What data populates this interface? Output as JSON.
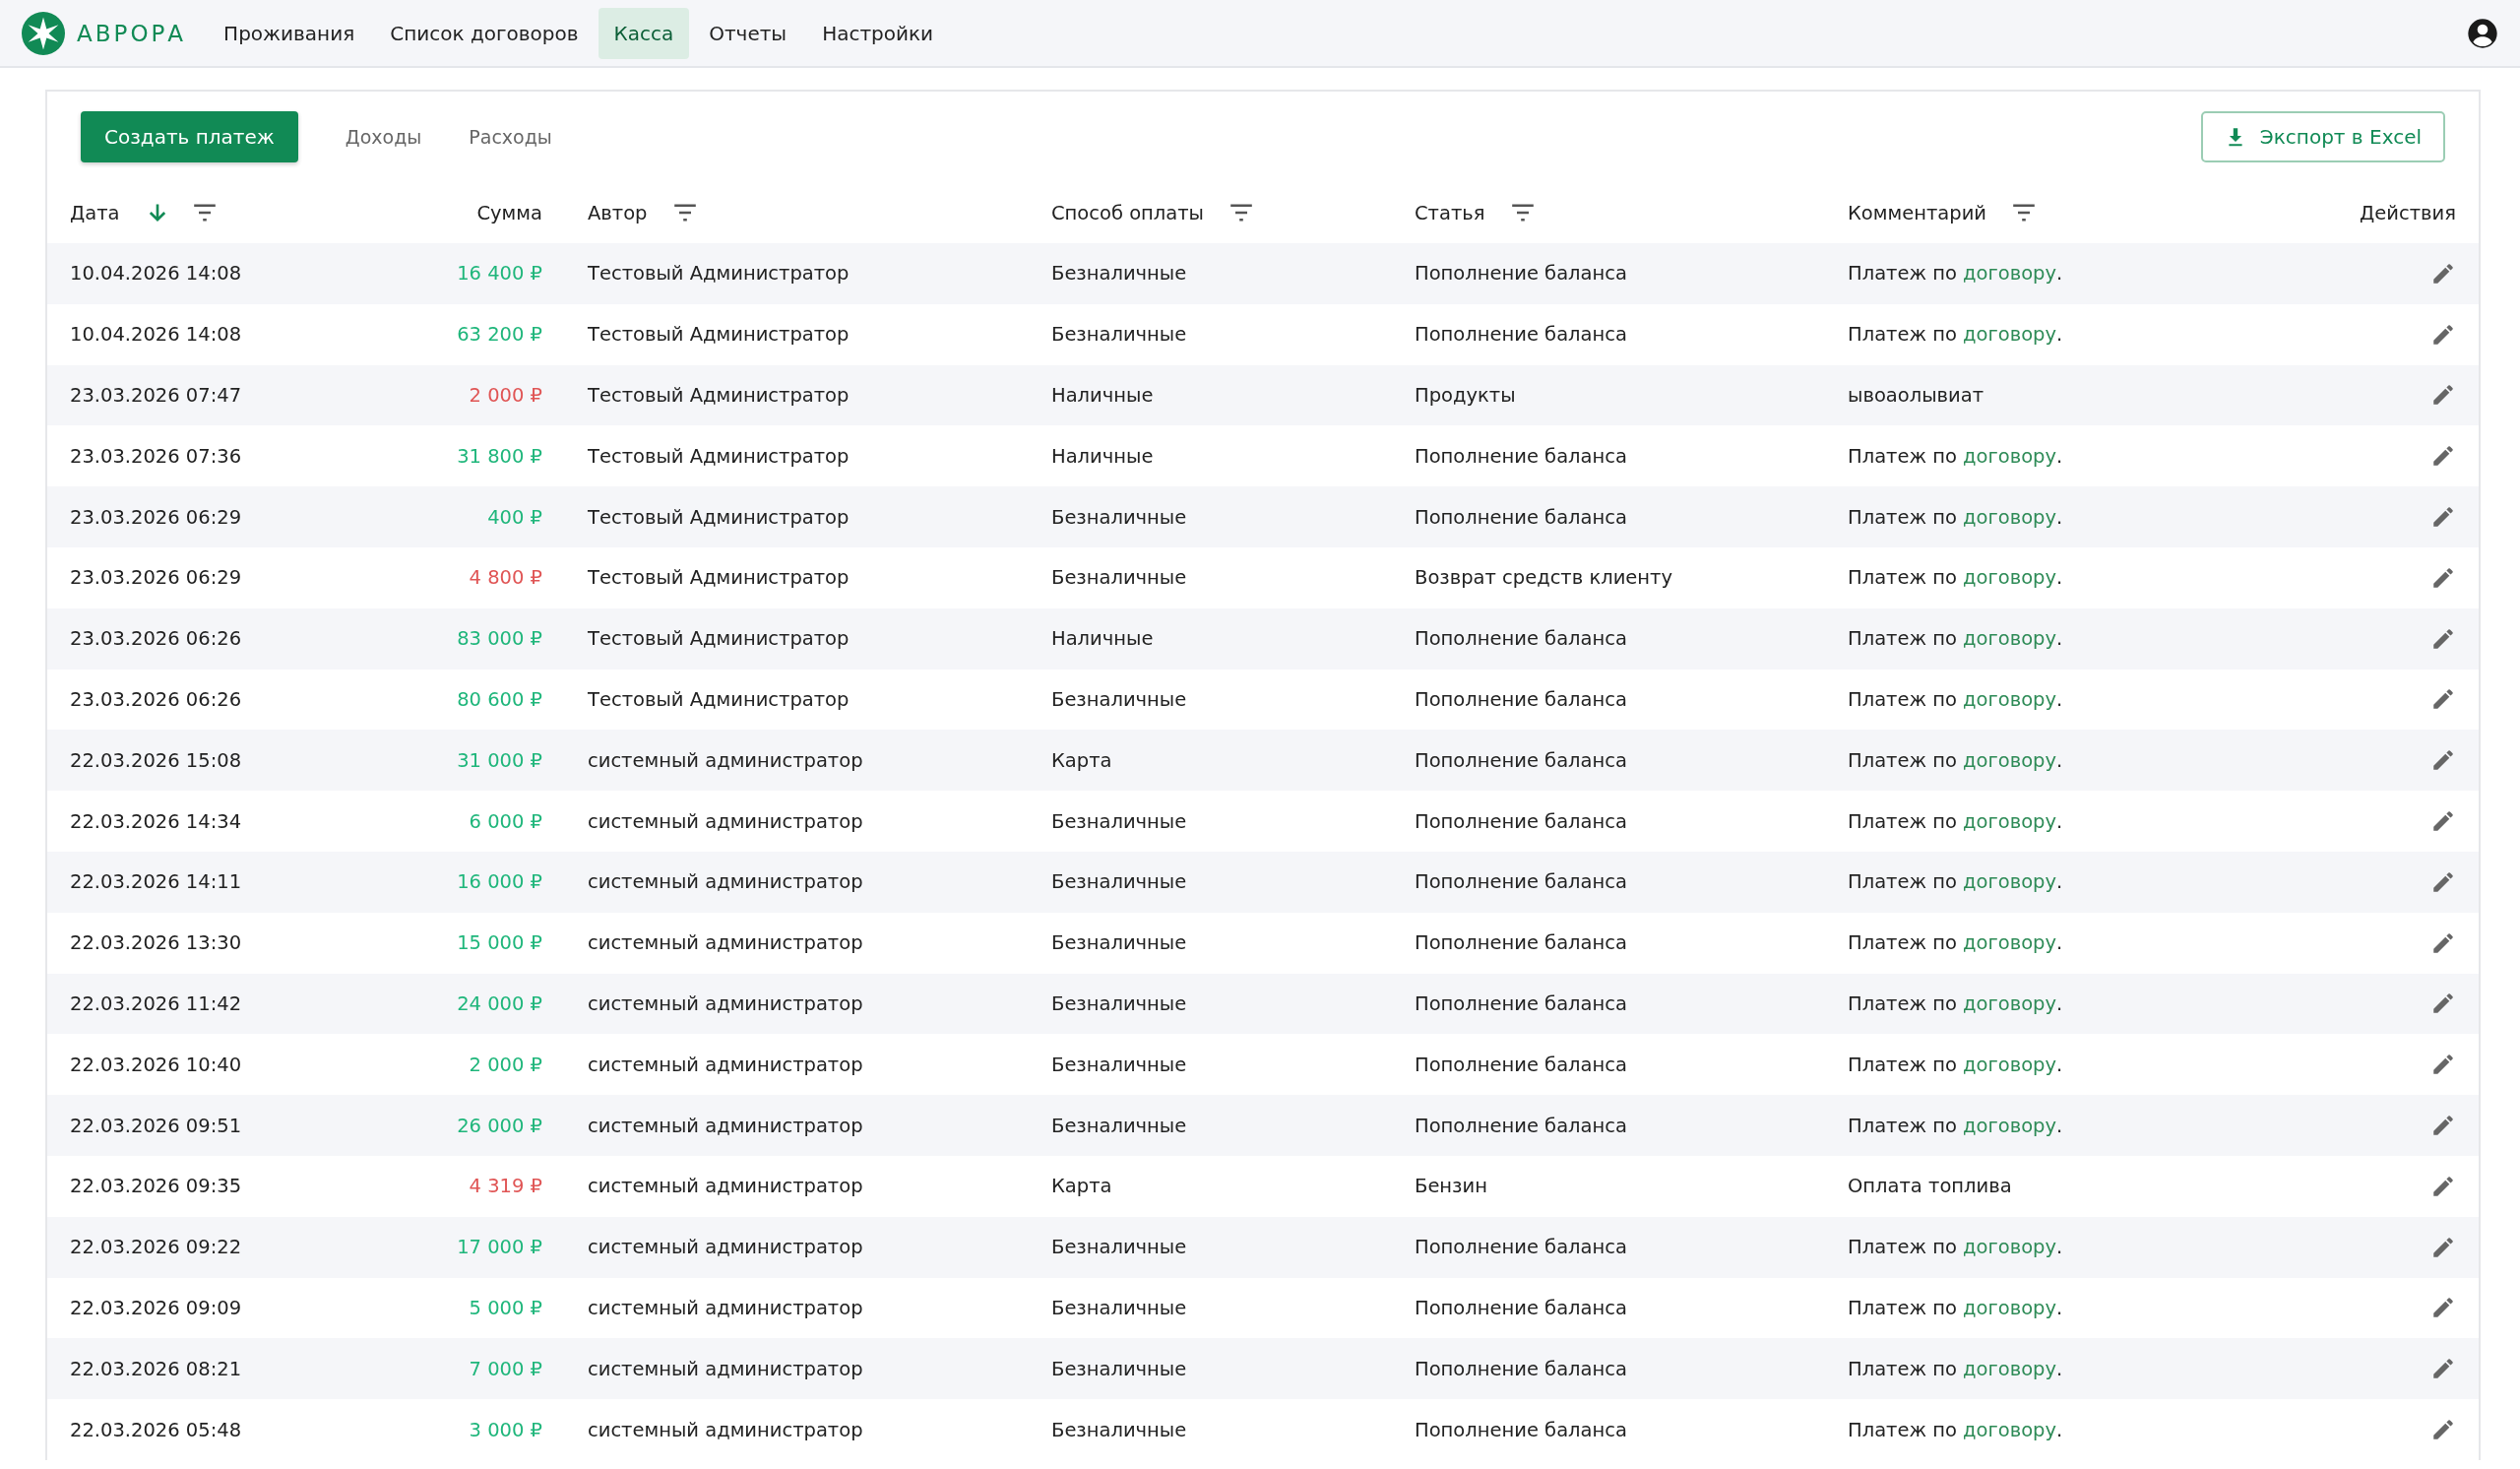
{
  "brand": "АВРОРА",
  "nav": [
    {
      "label": "Проживания",
      "selected": false
    },
    {
      "label": "Список договоров",
      "selected": false
    },
    {
      "label": "Касса",
      "selected": true
    },
    {
      "label": "Отчеты",
      "selected": false
    },
    {
      "label": "Настройки",
      "selected": false
    }
  ],
  "create_button": "Создать платеж",
  "tabs": [
    {
      "label": "Доходы",
      "selected": false
    },
    {
      "label": "Расходы",
      "selected": false
    }
  ],
  "export_button": "Экспорт в Excel",
  "columns": [
    {
      "label": "Дата",
      "sorted": true,
      "filter": true
    },
    {
      "label": "Сумма",
      "sorted": false,
      "filter": false
    },
    {
      "label": "Автор",
      "sorted": false,
      "filter": true
    },
    {
      "label": "Способ оплаты",
      "sorted": false,
      "filter": true
    },
    {
      "label": "Статья",
      "sorted": false,
      "filter": true
    },
    {
      "label": "Комментарий",
      "sorted": false,
      "filter": true
    },
    {
      "label": "Действия",
      "sorted": false,
      "filter": false
    }
  ],
  "rows": [
    {
      "date": "10.04.2026 14:08",
      "amount": "16 400 ₽",
      "kind": "income",
      "author": "Тестовый Администратор",
      "method": "Безналичные",
      "article": "Пополнение баланса",
      "comment": [
        {
          "kind": "text",
          "text": "Платеж по "
        },
        {
          "kind": "link",
          "text": "договору"
        },
        {
          "kind": "text",
          "text": "."
        }
      ]
    },
    {
      "date": "10.04.2026 14:08",
      "amount": "63 200 ₽",
      "kind": "income",
      "author": "Тестовый Администратор",
      "method": "Безналичные",
      "article": "Пополнение баланса",
      "comment": [
        {
          "kind": "text",
          "text": "Платеж по "
        },
        {
          "kind": "link",
          "text": "договору"
        },
        {
          "kind": "text",
          "text": "."
        }
      ]
    },
    {
      "date": "23.03.2026 07:47",
      "amount": "2 000 ₽",
      "kind": "expense",
      "author": "Тестовый Администратор",
      "method": "Наличные",
      "article": "Продукты",
      "comment": [
        {
          "kind": "text",
          "text": "ывоаолывиат"
        }
      ]
    },
    {
      "date": "23.03.2026 07:36",
      "amount": "31 800 ₽",
      "kind": "income",
      "author": "Тестовый Администратор",
      "method": "Наличные",
      "article": "Пополнение баланса",
      "comment": [
        {
          "kind": "text",
          "text": "Платеж по "
        },
        {
          "kind": "link",
          "text": "договору"
        },
        {
          "kind": "text",
          "text": "."
        }
      ]
    },
    {
      "date": "23.03.2026 06:29",
      "amount": "400 ₽",
      "kind": "income",
      "author": "Тестовый Администратор",
      "method": "Безналичные",
      "article": "Пополнение баланса",
      "comment": [
        {
          "kind": "text",
          "text": "Платеж по "
        },
        {
          "kind": "link",
          "text": "договору"
        },
        {
          "kind": "text",
          "text": "."
        }
      ]
    },
    {
      "date": "23.03.2026 06:29",
      "amount": "4 800 ₽",
      "kind": "expense",
      "author": "Тестовый Администратор",
      "method": "Безналичные",
      "article": "Возврат средств клиенту",
      "comment": [
        {
          "kind": "text",
          "text": "Платеж по "
        },
        {
          "kind": "link",
          "text": "договору"
        },
        {
          "kind": "text",
          "text": "."
        }
      ]
    },
    {
      "date": "23.03.2026 06:26",
      "amount": "83 000 ₽",
      "kind": "income",
      "author": "Тестовый Администратор",
      "method": "Наличные",
      "article": "Пополнение баланса",
      "comment": [
        {
          "kind": "text",
          "text": "Платеж по "
        },
        {
          "kind": "link",
          "text": "договору"
        },
        {
          "kind": "text",
          "text": "."
        }
      ]
    },
    {
      "date": "23.03.2026 06:26",
      "amount": "80 600 ₽",
      "kind": "income",
      "author": "Тестовый Администратор",
      "method": "Безналичные",
      "article": "Пополнение баланса",
      "comment": [
        {
          "kind": "text",
          "text": "Платеж по "
        },
        {
          "kind": "link",
          "text": "договору"
        },
        {
          "kind": "text",
          "text": "."
        }
      ]
    },
    {
      "date": "22.03.2026 15:08",
      "amount": "31 000 ₽",
      "kind": "income",
      "author": "системный администратор",
      "method": "Карта",
      "article": "Пополнение баланса",
      "comment": [
        {
          "kind": "text",
          "text": "Платеж по "
        },
        {
          "kind": "link",
          "text": "договору"
        },
        {
          "kind": "text",
          "text": "."
        }
      ]
    },
    {
      "date": "22.03.2026 14:34",
      "amount": "6 000 ₽",
      "kind": "income",
      "author": "системный администратор",
      "method": "Безналичные",
      "article": "Пополнение баланса",
      "comment": [
        {
          "kind": "text",
          "text": "Платеж по "
        },
        {
          "kind": "link",
          "text": "договору"
        },
        {
          "kind": "text",
          "text": "."
        }
      ]
    },
    {
      "date": "22.03.2026 14:11",
      "amount": "16 000 ₽",
      "kind": "income",
      "author": "системный администратор",
      "method": "Безналичные",
      "article": "Пополнение баланса",
      "comment": [
        {
          "kind": "text",
          "text": "Платеж по "
        },
        {
          "kind": "link",
          "text": "договору"
        },
        {
          "kind": "text",
          "text": "."
        }
      ]
    },
    {
      "date": "22.03.2026 13:30",
      "amount": "15 000 ₽",
      "kind": "income",
      "author": "системный администратор",
      "method": "Безналичные",
      "article": "Пополнение баланса",
      "comment": [
        {
          "kind": "text",
          "text": "Платеж по "
        },
        {
          "kind": "link",
          "text": "договору"
        },
        {
          "kind": "text",
          "text": "."
        }
      ]
    },
    {
      "date": "22.03.2026 11:42",
      "amount": "24 000 ₽",
      "kind": "income",
      "author": "системный администратор",
      "method": "Безналичные",
      "article": "Пополнение баланса",
      "comment": [
        {
          "kind": "text",
          "text": "Платеж по "
        },
        {
          "kind": "link",
          "text": "договору"
        },
        {
          "kind": "text",
          "text": "."
        }
      ]
    },
    {
      "date": "22.03.2026 10:40",
      "amount": "2 000 ₽",
      "kind": "income",
      "author": "системный администратор",
      "method": "Безналичные",
      "article": "Пополнение баланса",
      "comment": [
        {
          "kind": "text",
          "text": "Платеж по "
        },
        {
          "kind": "link",
          "text": "договору"
        },
        {
          "kind": "text",
          "text": "."
        }
      ]
    },
    {
      "date": "22.03.2026 09:51",
      "amount": "26 000 ₽",
      "kind": "income",
      "author": "системный администратор",
      "method": "Безналичные",
      "article": "Пополнение баланса",
      "comment": [
        {
          "kind": "text",
          "text": "Платеж по "
        },
        {
          "kind": "link",
          "text": "договору"
        },
        {
          "kind": "text",
          "text": "."
        }
      ]
    },
    {
      "date": "22.03.2026 09:35",
      "amount": "4 319 ₽",
      "kind": "expense",
      "author": "системный администратор",
      "method": "Карта",
      "article": "Бензин",
      "comment": [
        {
          "kind": "text",
          "text": "Оплата топлива"
        }
      ]
    },
    {
      "date": "22.03.2026 09:22",
      "amount": "17 000 ₽",
      "kind": "income",
      "author": "системный администратор",
      "method": "Безналичные",
      "article": "Пополнение баланса",
      "comment": [
        {
          "kind": "text",
          "text": "Платеж по "
        },
        {
          "kind": "link",
          "text": "договору"
        },
        {
          "kind": "text",
          "text": "."
        }
      ]
    },
    {
      "date": "22.03.2026 09:09",
      "amount": "5 000 ₽",
      "kind": "income",
      "author": "системный администратор",
      "method": "Безналичные",
      "article": "Пополнение баланса",
      "comment": [
        {
          "kind": "text",
          "text": "Платеж по "
        },
        {
          "kind": "link",
          "text": "договору"
        },
        {
          "kind": "text",
          "text": "."
        }
      ]
    },
    {
      "date": "22.03.2026 08:21",
      "amount": "7 000 ₽",
      "kind": "income",
      "author": "системный администратор",
      "method": "Безналичные",
      "article": "Пополнение баланса",
      "comment": [
        {
          "kind": "text",
          "text": "Платеж по "
        },
        {
          "kind": "link",
          "text": "договору"
        },
        {
          "kind": "text",
          "text": "."
        }
      ]
    },
    {
      "date": "22.03.2026 05:48",
      "amount": "3 000 ₽",
      "kind": "income",
      "author": "системный администратор",
      "method": "Безналичные",
      "article": "Пополнение баланса",
      "comment": [
        {
          "kind": "text",
          "text": "Платеж по "
        },
        {
          "kind": "link",
          "text": "договору"
        },
        {
          "kind": "text",
          "text": "."
        }
      ]
    }
  ]
}
